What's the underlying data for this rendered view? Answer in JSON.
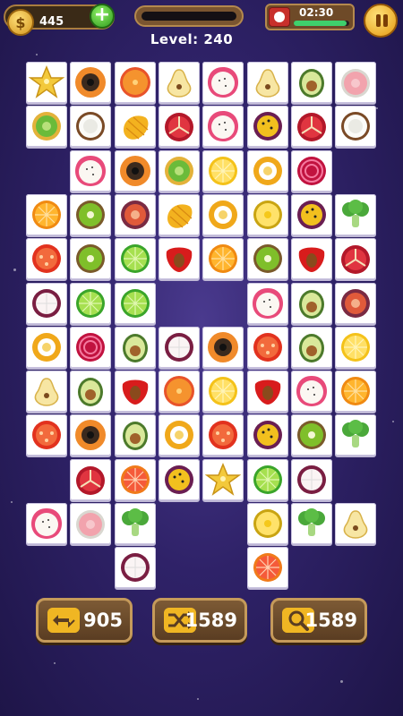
{
  "hud": {
    "coins": "445",
    "level_text": "Level: 240",
    "time": "02:30",
    "time_remaining_fraction": 0.95
  },
  "tiles": [
    [
      "starfruit",
      "papaya",
      "orange-slice",
      "pear",
      "dragonfruit",
      "pear",
      "avocado",
      "guava"
    ],
    [
      "kiwano",
      "coconut",
      "mango",
      "pomegranate",
      "dragonfruit",
      "passionfruit",
      "pomegranate",
      "coconut"
    ],
    [
      null,
      "dragonfruit",
      "papaya",
      "kiwano",
      "lemon",
      "yellow-pepper",
      "beet",
      null
    ],
    [
      "orange",
      "kiwi",
      "fig",
      "mango",
      "yellow-pepper",
      "pineapple",
      "passionfruit",
      "broccoli"
    ],
    [
      "tomato",
      "kiwi",
      "lime",
      "strawberry",
      "orange",
      "kiwi",
      "strawberry",
      "pomegranate"
    ],
    [
      "mangosteen",
      "lime",
      "lime",
      null,
      null,
      "dragonfruit",
      "avocado",
      "fig"
    ],
    [
      "yellow-pepper",
      "beet",
      "avocado",
      "mangosteen",
      "papaya",
      "tomato",
      "avocado",
      "lemon"
    ],
    [
      "pear",
      "avocado",
      "strawberry",
      "orange-slice",
      "lemon",
      "strawberry",
      "dragonfruit",
      "orange"
    ],
    [
      "tomato",
      "papaya",
      "avocado",
      "yellow-pepper",
      "tomato",
      "passionfruit",
      "kiwi",
      "broccoli"
    ],
    [
      null,
      "pomegranate",
      "grapefruit",
      "passionfruit",
      "starfruit",
      "lime",
      "mangosteen",
      null
    ],
    [
      "dragonfruit",
      "guava",
      "broccoli",
      null,
      null,
      "pineapple",
      "broccoli",
      "pear"
    ],
    [
      null,
      null,
      "mangosteen",
      null,
      null,
      "grapefruit",
      null,
      null
    ]
  ],
  "buttons": {
    "undo": {
      "icon": "undo-arrows-icon",
      "count": "905"
    },
    "shuffle": {
      "icon": "shuffle-icon",
      "count": "1589"
    },
    "hint": {
      "icon": "magnifier-icon",
      "count": "1589"
    }
  }
}
